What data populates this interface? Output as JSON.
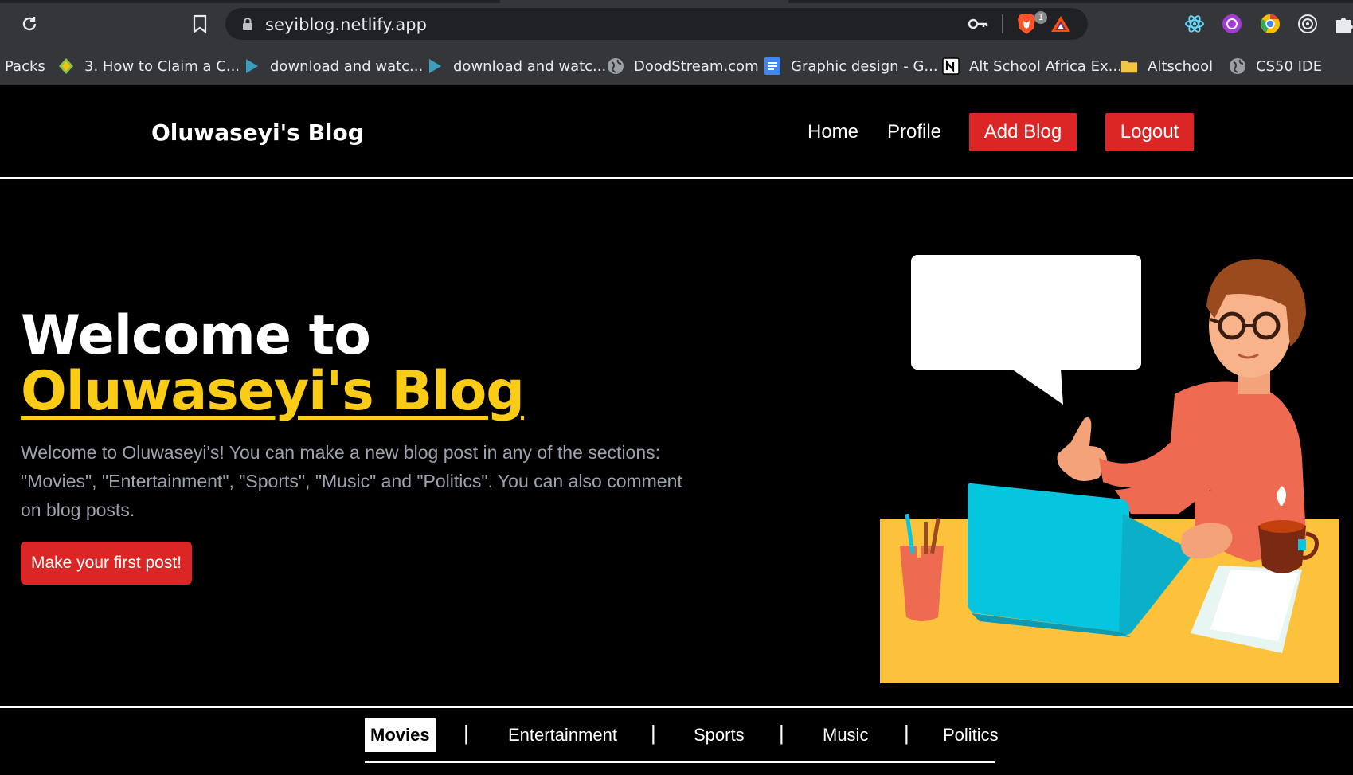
{
  "browser": {
    "url": "seyiblog.netlify.app",
    "shield_badge": "1",
    "icons": {
      "reload": "reload-icon",
      "bookmark": "bookmark-icon",
      "lock": "lock-icon",
      "key": "key-icon",
      "brave": "brave-shield-icon",
      "rewards": "brave-rewards-icon",
      "extensions": [
        "react-devtools-icon",
        "ext-purple-icon",
        "ext-chrome-icon",
        "ext-target-icon",
        "puzzle-icon"
      ]
    },
    "bookmarks": [
      {
        "label": "Packs",
        "icon": "none"
      },
      {
        "label": "3. How to Claim a C...",
        "icon": "diamond-icon"
      },
      {
        "label": "download and watc...",
        "icon": "play-icon"
      },
      {
        "label": "download and watc...",
        "icon": "play-icon"
      },
      {
        "label": "DoodStream.com",
        "icon": "globe-icon"
      },
      {
        "label": "Graphic design - G...",
        "icon": "docs-icon"
      },
      {
        "label": "Alt School Africa Ex...",
        "icon": "notion-icon"
      },
      {
        "label": "Altschool",
        "icon": "folder-icon"
      },
      {
        "label": "CS50 IDE",
        "icon": "globe-icon"
      }
    ]
  },
  "header": {
    "logo": "Oluwaseyi's Blog",
    "nav": {
      "home": "Home",
      "profile": "Profile",
      "add_blog": "Add Blog",
      "logout": "Logout"
    }
  },
  "hero": {
    "title_line1": "Welcome to",
    "title_line2": "Oluwaseyi's Blog",
    "description": "Welcome to Oluwaseyi's! You can make a new blog post in any of the sections: \"Movies\", \"Entertainment\", \"Sports\", \"Music\" and \"Politics\". You can also comment on blog posts.",
    "cta": "Make your first post!"
  },
  "categories": {
    "items": [
      "Movies",
      "Entertainment",
      "Sports",
      "Music",
      "Politics"
    ],
    "active": "Movies",
    "separator": "|"
  },
  "colors": {
    "accent_red": "#dc2626",
    "accent_yellow": "#facc15",
    "background": "#000000"
  }
}
